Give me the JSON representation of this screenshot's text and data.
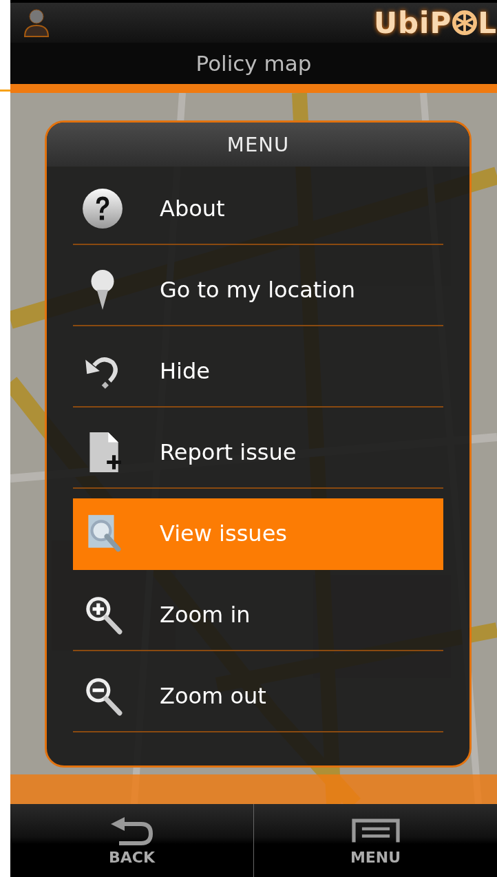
{
  "header": {
    "logo_before": "UbiP",
    "logo_after": "L"
  },
  "title": "Policy map",
  "menu": {
    "title": "MENU",
    "items": [
      {
        "kind": "about",
        "label": "About",
        "selected": false
      },
      {
        "kind": "location",
        "label": "Go to my location",
        "selected": false
      },
      {
        "kind": "hide",
        "label": "Hide",
        "selected": false
      },
      {
        "kind": "report",
        "label": "Report issue",
        "selected": false
      },
      {
        "kind": "view",
        "label": "View issues",
        "selected": true
      },
      {
        "kind": "zoomin",
        "label": "Zoom in",
        "selected": false
      },
      {
        "kind": "zoomout",
        "label": "Zoom out",
        "selected": false
      }
    ]
  },
  "bottom_bar": [
    {
      "kind": "back",
      "label": "BACK"
    },
    {
      "kind": "menu",
      "label": "MENU"
    }
  ]
}
